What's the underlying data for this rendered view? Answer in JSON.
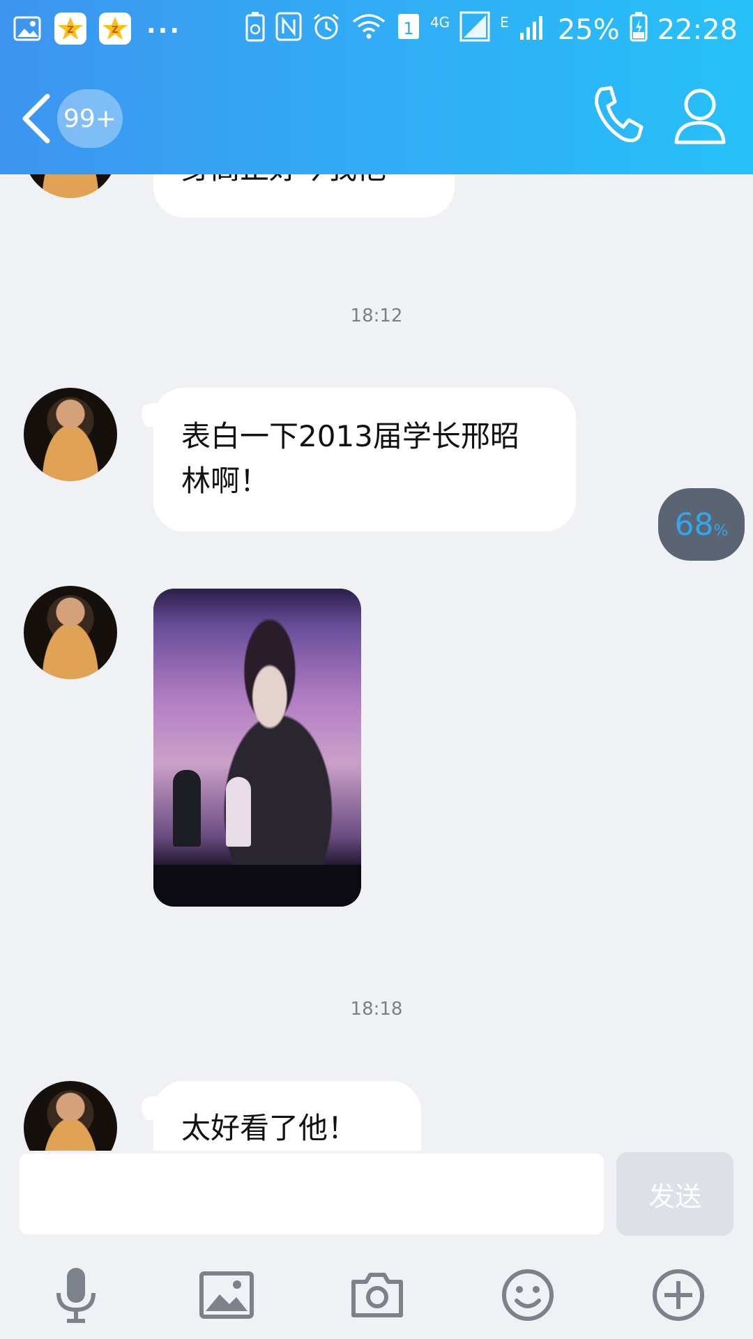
{
  "status_bar": {
    "qzone_badge": "Z",
    "more_dots": "...",
    "sim_slot": "1",
    "network_4g": "4G",
    "network_e": "E",
    "battery_percent": "25%",
    "clock": "22:28"
  },
  "nav": {
    "unread_count": "99+"
  },
  "messages": {
    "top_cut_text": "身高正好今我他",
    "time_1": "18:12",
    "msg_1": "表白一下2013届学长邢昭林啊！",
    "time_2": "18:18",
    "msg_3": "太好看了他！"
  },
  "upload": {
    "progress_value": "68",
    "progress_unit": "%"
  },
  "composer": {
    "input_value": "",
    "send_label": "发送"
  },
  "colors": {
    "header_start": "#3d95f0",
    "header_end": "#27c0f8",
    "background": "#eff1f5",
    "progress_text": "#2fa8f2"
  },
  "icons": [
    "image-icon",
    "qzone-icon",
    "battery-saver-icon",
    "nfc-icon",
    "alarm-icon",
    "wifi-icon",
    "signal-icon",
    "battery-icon",
    "back-arrow-icon",
    "phone-icon",
    "person-icon",
    "microphone-icon",
    "picture-icon",
    "camera-icon",
    "emoji-icon",
    "plus-circle-icon"
  ]
}
